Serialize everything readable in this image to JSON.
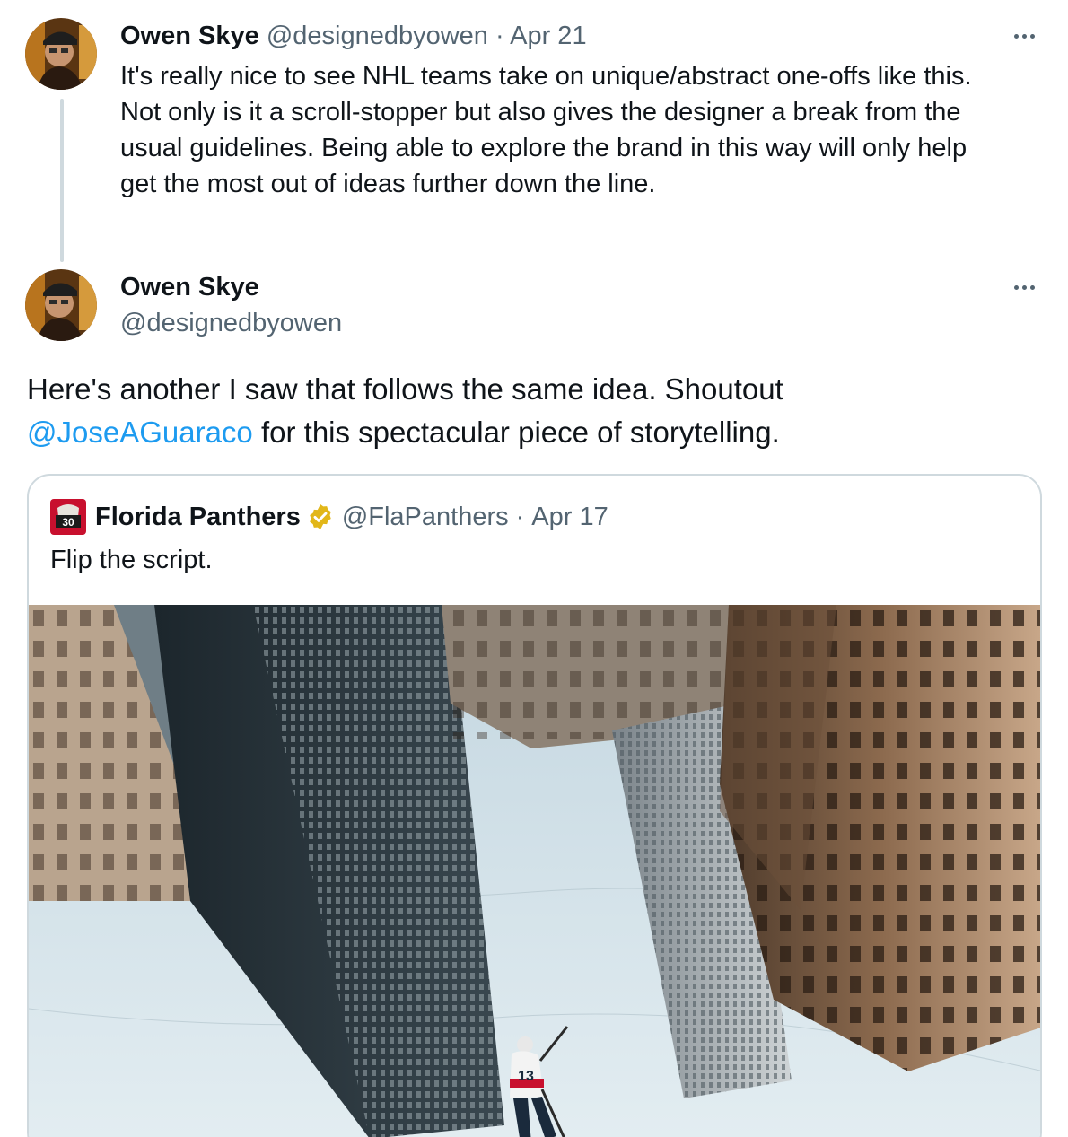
{
  "first_tweet": {
    "author_name": "Owen Skye",
    "author_handle": "@designedbyowen",
    "separator": "·",
    "date": "Apr 21",
    "text_lines": [
      "It's really nice to see NHL teams take on unique/abstract one-offs like this.",
      "Not only is it a scroll-stopper but also gives the designer a break from the",
      "usual guidelines. Being able to explore the brand in this way will only help",
      "get the most out of ideas further down the line."
    ]
  },
  "main_tweet": {
    "author_name": "Owen Skye",
    "author_handle": "@designedbyowen",
    "text_line1": "Here's another I saw that follows the same idea. Shoutout",
    "mention": "@JoseAGuaraco",
    "text_line2_rest": " for this spectacular piece of storytelling."
  },
  "quoted_tweet": {
    "author_name": "Florida Panthers",
    "author_handle": "@FlaPanthers",
    "separator": "·",
    "date": "Apr 17",
    "text": "Flip the script.",
    "avatar_badge": "30",
    "verified_color": "#e2b719",
    "jersey_number": "13"
  },
  "colors": {
    "text_primary": "#0f1419",
    "text_secondary": "#536471",
    "link": "#1d9bf0",
    "border": "#cfd9de"
  },
  "icons": {
    "more": "more-dots-icon",
    "verified": "verified-badge-icon"
  }
}
